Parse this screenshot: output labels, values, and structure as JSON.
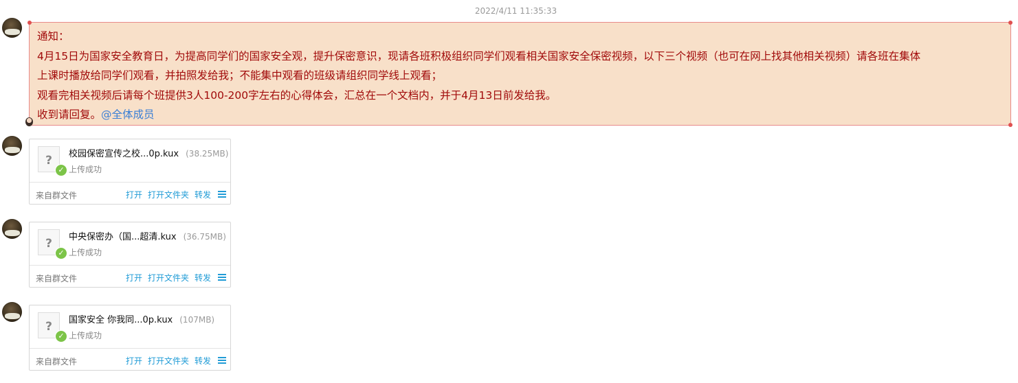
{
  "timestamp": "2022/4/11 11:35:33",
  "notice": {
    "lines": [
      "通知：",
      "4月15日为国家安全教育日，为提高同学们的国家安全观，提升保密意识，现请各班积极组织同学们观看相关国家安全保密视频，以下三个视频（也可在网上找其他相关视频）请各班在集体",
      "上课时播放给同学们观看，并拍照发给我；不能集中观看的班级请组织同学线上观看；",
      "观看完相关视频后请每个班提供3人100-200字左右的心得体会，汇总在一个文档内，并于4月13日前发给我。",
      "收到请回复。"
    ],
    "mention": "@全体成员"
  },
  "files": [
    {
      "name": "校园保密宣传之校...0p.kux",
      "size": "(38.25MB)",
      "status": "上传成功",
      "source": "来自群文件",
      "open": "打开",
      "open_folder": "打开文件夹",
      "forward": "转发"
    },
    {
      "name": "中央保密办（国...超清.kux",
      "size": "(36.75MB)",
      "status": "上传成功",
      "source": "来自群文件",
      "open": "打开",
      "open_folder": "打开文件夹",
      "forward": "转发"
    },
    {
      "name": "国家安全 你我同...0p.kux",
      "size": "(107MB)",
      "status": "上传成功",
      "source": "来自群文件",
      "open": "打开",
      "open_folder": "打开文件夹",
      "forward": "转发"
    }
  ],
  "icons": {
    "file_icon_glyph": "?",
    "check_glyph": "✓"
  },
  "colors": {
    "notice_bg": "#f8e0c9",
    "notice_text": "#a10a0a",
    "notice_border": "#e88a8a",
    "mention": "#3a7fd6",
    "action_link": "#1f9bd6",
    "success_check": "#7cc448"
  }
}
